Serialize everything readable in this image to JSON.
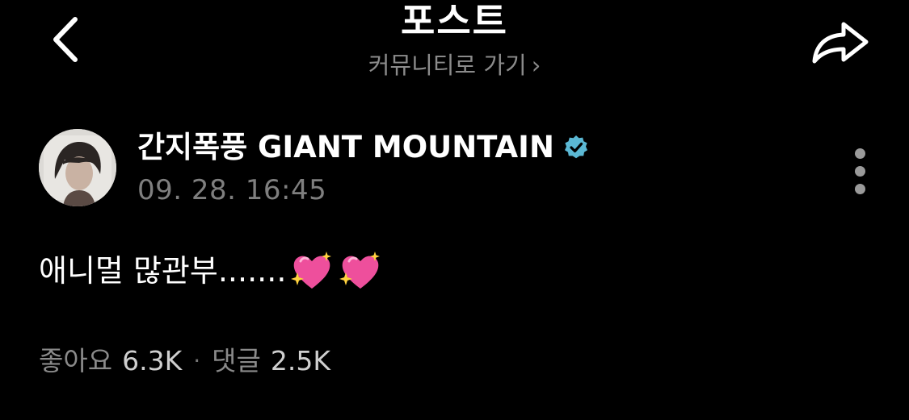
{
  "header": {
    "title": "포스트",
    "community_link_label": "커뮤니티로 가기",
    "community_link_chevron": "›",
    "back_icon": "chevron-left-icon",
    "share_icon": "share-arrow-icon"
  },
  "post": {
    "author_name": "간지폭풍 GIANT MOUNTAIN",
    "verified_icon": "verified-badge-icon",
    "verified_color": "#5bb8d4",
    "timestamp": "09. 28. 16:45",
    "more_icon": "more-vertical-icon",
    "text": "애니멀 많관부.......",
    "emojis": [
      "sparkling-heart-emoji",
      "sparkling-heart-emoji"
    ],
    "emoji_color": "#ee4f9c",
    "likes_label": "좋아요",
    "likes_count": "6.3K",
    "separator": "·",
    "comments_label": "댓글",
    "comments_count": "2.5K"
  },
  "colors": {
    "background": "#000000",
    "primary_text": "#ffffff",
    "secondary_text": "#8b8b8b"
  }
}
